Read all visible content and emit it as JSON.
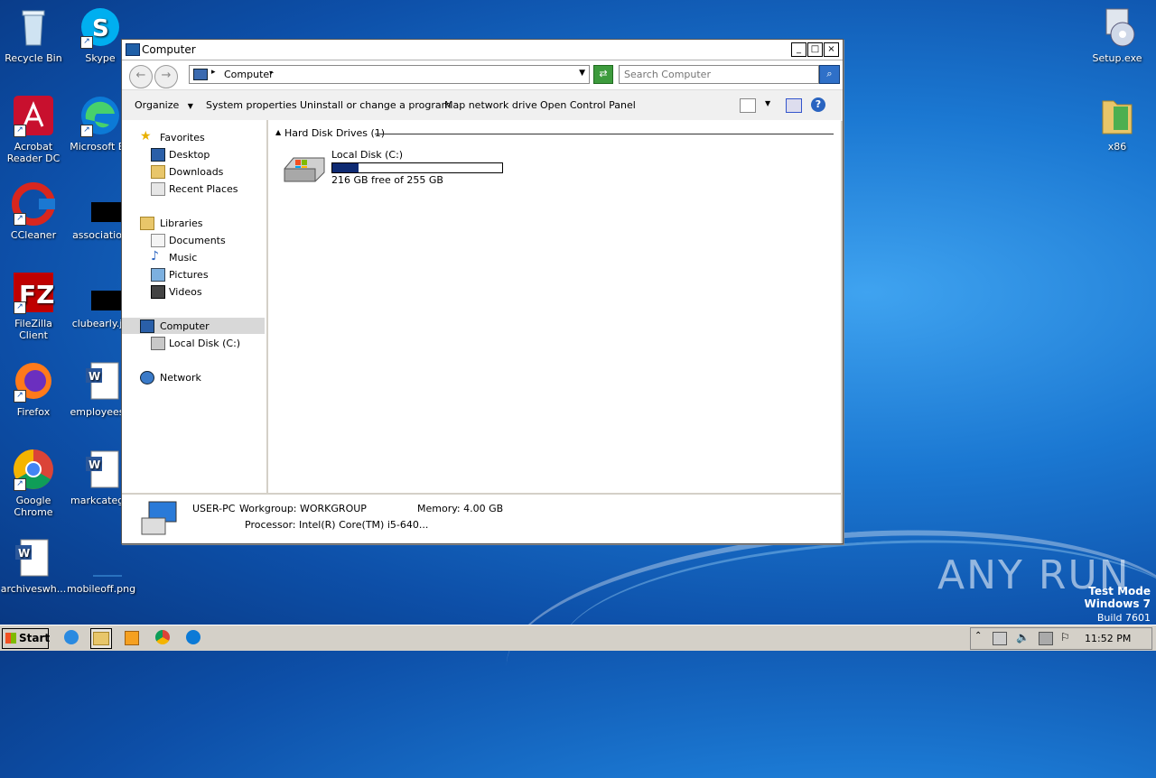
{
  "desktop": {
    "icons": [
      {
        "label": "Recycle Bin",
        "icon": "recycle-bin-icon"
      },
      {
        "label": "Skype",
        "icon": "skype-icon"
      },
      {
        "label": "Acrobat Reader DC",
        "icon": "acrobat-icon"
      },
      {
        "label": "Microsoft Ed",
        "icon": "edge-icon"
      },
      {
        "label": "CCleaner",
        "icon": "ccleaner-icon"
      },
      {
        "label": "association",
        "icon": "image-file-icon"
      },
      {
        "label": "FileZilla Client",
        "icon": "filezilla-icon"
      },
      {
        "label": "clubearly.jp",
        "icon": "image-file-icon"
      },
      {
        "label": "Firefox",
        "icon": "firefox-icon"
      },
      {
        "label": "employeesh",
        "icon": "word-doc-icon"
      },
      {
        "label": "Google Chrome",
        "icon": "chrome-icon"
      },
      {
        "label": "markcatego",
        "icon": "word-doc-icon"
      },
      {
        "label": "archiveswh...",
        "icon": "word-doc-icon"
      },
      {
        "label": "mobileoff.png",
        "icon": "image-file-icon"
      },
      {
        "label": "Setup.exe",
        "icon": "setup-icon"
      },
      {
        "label": "x86",
        "icon": "folder-icon"
      }
    ],
    "watermark": {
      "brand": "ANY RUN",
      "mode": "Test Mode",
      "os": "Windows 7",
      "build": "Build 7601"
    }
  },
  "window": {
    "title": "Computer",
    "address": "Computer",
    "search_placeholder": "Search Computer",
    "toolbar": {
      "organize": "Organize",
      "system_properties": "System properties",
      "uninstall": "Uninstall or change a program",
      "map_drive": "Map network drive",
      "control_panel": "Open Control Panel"
    },
    "nav": {
      "favorites": "Favorites",
      "desktop": "Desktop",
      "downloads": "Downloads",
      "recent": "Recent Places",
      "libraries": "Libraries",
      "documents": "Documents",
      "music": "Music",
      "pictures": "Pictures",
      "videos": "Videos",
      "computer": "Computer",
      "local_disk": "Local Disk (C:)",
      "network": "Network"
    },
    "content": {
      "group_header": "Hard Disk Drives (1)",
      "drive_name": "Local Disk (C:)",
      "drive_free": "216 GB free of 255 GB",
      "drive_used_fraction": 0.153
    },
    "status": {
      "pc_name": "USER-PC",
      "workgroup": "Workgroup: WORKGROUP",
      "memory": "Memory: 4.00 GB",
      "processor": "Processor: Intel(R) Core(TM) i5-640..."
    }
  },
  "taskbar": {
    "start": "Start",
    "time": "11:52 PM"
  }
}
